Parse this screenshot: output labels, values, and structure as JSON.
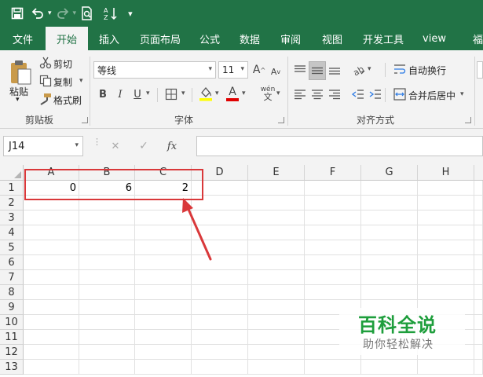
{
  "qat": {
    "save_icon": "save-icon",
    "undo_icon": "undo-icon",
    "redo_icon": "redo-icon",
    "print_preview_icon": "print-preview-icon",
    "sort_icon": "sort-icon",
    "customize_icon": "customize-icon"
  },
  "tabs": [
    "文件",
    "开始",
    "插入",
    "页面布局",
    "公式",
    "数据",
    "审阅",
    "视图",
    "开发工具",
    "view",
    "福"
  ],
  "active_tab": "开始",
  "ribbon": {
    "clipboard": {
      "paste": "粘贴",
      "cut": "剪切",
      "copy": "复制",
      "format_painter": "格式刷",
      "label": "剪贴板"
    },
    "font": {
      "font_name": "等线",
      "font_size": "11",
      "phonetic": "wén",
      "bold": "B",
      "italic": "I",
      "underline": "U",
      "font_color_letter": "A",
      "grow_letter": "A",
      "shrink_letter": "A",
      "label": "字体"
    },
    "alignment": {
      "wrap_text": "自动换行",
      "merge_center": "合并后居中",
      "label": "对齐方式"
    }
  },
  "formula_bar": {
    "name_box": "J14",
    "cancel": "✕",
    "enter": "✓",
    "fx": "fx",
    "content": ""
  },
  "sheet": {
    "columns": [
      "A",
      "B",
      "C",
      "D",
      "E",
      "F",
      "G",
      "H"
    ],
    "rows": [
      "1",
      "2",
      "3",
      "4",
      "5",
      "6",
      "7",
      "8",
      "9",
      "10",
      "11",
      "12",
      "13"
    ],
    "row1": [
      "0",
      "6",
      "2"
    ]
  },
  "annotation": {
    "box_color": "#d9383a"
  },
  "watermark": {
    "title": "百科全说",
    "subtitle": "助你轻松解决"
  },
  "colors": {
    "excel_green": "#217346",
    "watermark_green": "#1e9e3c"
  }
}
